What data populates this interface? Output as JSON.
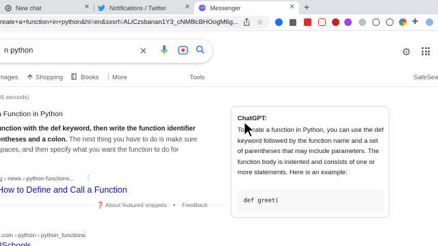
{
  "tabs": [
    {
      "title": "New chat",
      "favicon": "chatgpt-icon",
      "close": "✕"
    },
    {
      "title": "Notifications / Twitter",
      "favicon": "twitter-icon",
      "close": "✕"
    },
    {
      "title": "Messenger",
      "favicon": "messenger-icon",
      "close": "✕"
    }
  ],
  "new_tab_label": "+",
  "address": {
    "url": "reate+a+function+in+python&hl=en&sxsrf=ALiCzsbanan1Y3_cNM8lcBHOogM6g..."
  },
  "search": {
    "query": "n python",
    "clear_icon": "✕"
  },
  "filters": [
    "mages",
    "Shopping",
    "Books",
    "More",
    "Tools",
    "SafeSea"
  ],
  "stats": ".36 seconds)",
  "snippet": {
    "title": "a Function in Python",
    "line1_bold": "unction with the def keyword, then write the function identifier",
    "line2_bold": "entheses and a colon.",
    "line2_rest": " The next thing you have to do is make sure",
    "line3": " spaces, and then specify what you want the function to do for",
    "cite": "rg › news › python-functions...",
    "link": "How to Define and Call a Function",
    "about_label": "About featured snippets",
    "feedback_label": "Feedback"
  },
  "result2": {
    "cite": "n.com › python › python_functions",
    "link": "3Schools"
  },
  "chatgpt": {
    "heading": "ChatGPT:",
    "text": "To create a function in Python, you can use the def keyword followed by the function name and a set of parentheses that may include parameters. The function body is indented and consists of one or more statements. Here is an example:",
    "code": "def greet("
  },
  "colors": {
    "link": "#1a0dab",
    "tabstrip": "#dee1e6",
    "twitter": "#1d9bf0"
  }
}
